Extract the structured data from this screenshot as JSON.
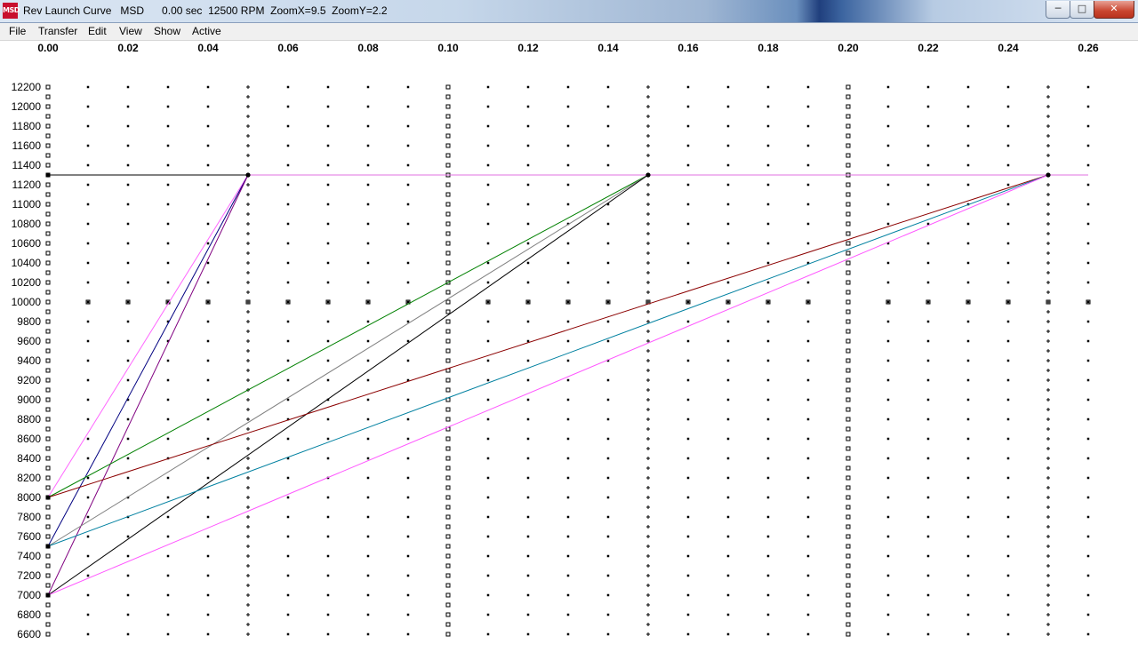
{
  "window": {
    "title": "Rev Launch Curve   MSD      0.00 sec  12500 RPM  ZoomX=9.5  ZoomY=2.2",
    "logo_text": "MSD",
    "minimize_glyph": "─",
    "maximize_glyph": "□",
    "close_glyph": "✕"
  },
  "menu": {
    "items": [
      "File",
      "Transfer",
      "Edit",
      "View",
      "Show",
      "Active"
    ]
  },
  "chart_data": {
    "type": "line",
    "title": "",
    "xlabel": "",
    "ylabel": "",
    "xlim": [
      0.0,
      0.26
    ],
    "ylim": [
      6600,
      12200
    ],
    "x_ticks": [
      0.0,
      0.02,
      0.04,
      0.06,
      0.08,
      0.1,
      0.12,
      0.14,
      0.16,
      0.18,
      0.2,
      0.22,
      0.24,
      0.26
    ],
    "x_tick_labels": [
      "0.00",
      "0.02",
      "0.04",
      "0.06",
      "0.08",
      "0.10",
      "0.12",
      "0.14",
      "0.16",
      "0.18",
      "0.20",
      "0.22",
      "0.24",
      "0.26"
    ],
    "y_ticks": [
      12200,
      12000,
      11800,
      11600,
      11400,
      11200,
      11000,
      10800,
      10600,
      10400,
      10200,
      10000,
      9800,
      9600,
      9400,
      9200,
      9000,
      8800,
      8600,
      8400,
      8200,
      8000,
      7800,
      7600,
      7400,
      7200,
      7000,
      6800,
      6600
    ],
    "y_tick_labels": [
      "12200",
      "12000",
      "11800",
      "11600",
      "11400",
      "11200",
      "11000",
      "10800",
      "10600",
      "10400",
      "10200",
      "10000",
      "9800",
      "9600",
      "9400",
      "9200",
      "9000",
      "8800",
      "8600",
      "8400",
      "8200",
      "8000",
      "7800",
      "7600",
      "7400",
      "7200",
      "7000",
      "6800",
      "6600"
    ],
    "grid": "dotted",
    "series": [
      {
        "color": "#000000",
        "points": [
          [
            0.0,
            11300
          ],
          [
            0.26,
            11300
          ]
        ]
      },
      {
        "color": "#e070e0",
        "points": [
          [
            0.05,
            11300
          ],
          [
            0.26,
            11300
          ]
        ]
      },
      {
        "color": "#ff66ff",
        "points": [
          [
            0.0,
            8000
          ],
          [
            0.05,
            11300
          ]
        ]
      },
      {
        "color": "#000080",
        "points": [
          [
            0.0,
            7500
          ],
          [
            0.05,
            11300
          ]
        ]
      },
      {
        "color": "#800080",
        "points": [
          [
            0.0,
            7000
          ],
          [
            0.05,
            11300
          ]
        ]
      },
      {
        "color": "#008000",
        "points": [
          [
            0.0,
            8000
          ],
          [
            0.15,
            11300
          ]
        ]
      },
      {
        "color": "#808080",
        "points": [
          [
            0.0,
            7500
          ],
          [
            0.15,
            11300
          ]
        ]
      },
      {
        "color": "#000000",
        "points": [
          [
            0.0,
            7000
          ],
          [
            0.15,
            11300
          ]
        ]
      },
      {
        "color": "#8b0000",
        "points": [
          [
            0.0,
            8000
          ],
          [
            0.25,
            11300
          ]
        ]
      },
      {
        "color": "#0080a0",
        "points": [
          [
            0.0,
            7500
          ],
          [
            0.25,
            11300
          ]
        ]
      },
      {
        "color": "#ff55ff",
        "points": [
          [
            0.0,
            7000
          ],
          [
            0.25,
            11300
          ]
        ]
      }
    ],
    "markers": [
      [
        0.0,
        11300
      ],
      [
        0.05,
        11300
      ],
      [
        0.15,
        11300
      ],
      [
        0.25,
        11300
      ],
      [
        0.0,
        8000
      ],
      [
        0.0,
        7500
      ],
      [
        0.0,
        7000
      ]
    ]
  }
}
